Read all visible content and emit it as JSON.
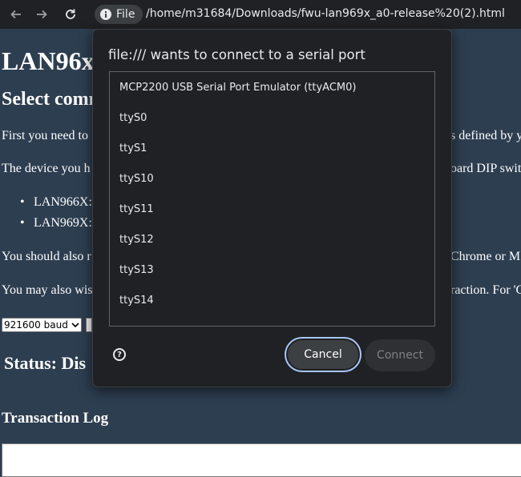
{
  "browser": {
    "site_chip_label": "File",
    "url": "/home/m31684/Downloads/fwu-lan969x_a0-release%20(2).html"
  },
  "page": {
    "title": "LAN96x",
    "heading": "Select comm",
    "para1_left": "First you need to",
    "para1_right": "s defined by y",
    "para2_left": "The device you h",
    "para2_right": "oard DIP switc",
    "list": [
      "LAN966X:",
      "LAN969X:"
    ],
    "para3_left": "You should also r",
    "para3_right": "Chrome or MS",
    "para4_left": "You may also wis",
    "para4_right": "raction. For 'C",
    "baud_select": "921600 baud",
    "status": "Status: Dis",
    "log_heading": "Transaction Log"
  },
  "dialog": {
    "title": "file:/// wants to connect to a serial port",
    "ports": [
      "MCP2200 USB Serial Port Emulator (ttyACM0)",
      "ttyS0",
      "ttyS1",
      "ttyS10",
      "ttyS11",
      "ttyS12",
      "ttyS13",
      "ttyS14"
    ],
    "help_glyph": "?",
    "cancel_label": "Cancel",
    "connect_label": "Connect"
  }
}
